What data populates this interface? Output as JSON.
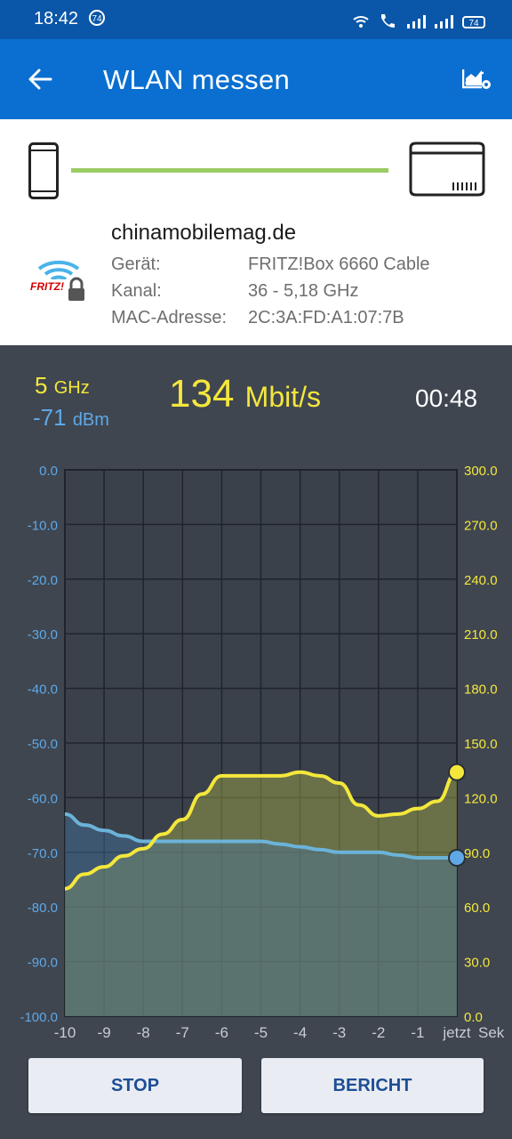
{
  "status_bar": {
    "time": "18:42",
    "notification_count": "74",
    "battery": "74"
  },
  "app_bar": {
    "title": "WLAN messen",
    "back_icon": "arrow-left-icon",
    "action_icon": "report-settings-icon"
  },
  "device": {
    "ssid": "chinamobilemag.de",
    "labels": [
      "Gerät:",
      "Kanal:",
      "MAC-Adresse:"
    ],
    "values": [
      "FRITZ!Box 6660 Cable",
      "36 - 5,18 GHz",
      "2C:3A:FD:A1:07:7B"
    ],
    "connection_color": "#9ccc65"
  },
  "measurement": {
    "band": "5",
    "band_unit": "GHz",
    "signal": "-71",
    "signal_unit": "dBm",
    "speed": "134",
    "speed_unit": "Mbit/s",
    "elapsed": "00:48"
  },
  "chart_data": {
    "type": "line",
    "x_ticks": [
      "-10",
      "-9",
      "-8",
      "-7",
      "-6",
      "-5",
      "-4",
      "-3",
      "-2",
      "-1",
      "jetzt",
      "Sek"
    ],
    "x": [
      -10,
      -9.5,
      -9,
      -8.5,
      -8,
      -7.5,
      -7,
      -6.5,
      -6,
      -5.5,
      -5,
      -4.5,
      -4,
      -3.5,
      -3,
      -2.5,
      -2,
      -1.5,
      -1,
      -0.5,
      0
    ],
    "left_axis": {
      "ticks": [
        "0.0",
        "-10.0",
        "-20.0",
        "-30.0",
        "-40.0",
        "-50.0",
        "-60.0",
        "-70.0",
        "-80.0",
        "-90.0",
        "-100.0"
      ],
      "range": [
        -100,
        0
      ],
      "color": "#5fa8e6"
    },
    "right_axis": {
      "ticks": [
        "300.0",
        "270.0",
        "240.0",
        "210.0",
        "180.0",
        "150.0",
        "120.0",
        "90.0",
        "60.0",
        "30.0",
        "0.0"
      ],
      "range": [
        0,
        300
      ],
      "color": "#f4e73b"
    },
    "series": [
      {
        "axis": "left",
        "color": "#6bb3d9",
        "values": [
          -63,
          -65,
          -66,
          -67,
          -68,
          -68,
          -68,
          -68,
          -68,
          -68,
          -68,
          -68.5,
          -69,
          -69.5,
          -70,
          -70,
          -70,
          -70.5,
          -71,
          -71,
          -71
        ]
      },
      {
        "axis": "right",
        "color": "#f4e73b",
        "values": [
          70,
          78,
          82,
          88,
          92,
          100,
          108,
          122,
          132,
          132,
          132,
          132,
          134,
          132,
          128,
          116,
          110,
          111,
          114,
          118,
          134
        ]
      }
    ],
    "grid": true
  },
  "buttons": {
    "stop": "STOP",
    "report": "BERICHT"
  }
}
